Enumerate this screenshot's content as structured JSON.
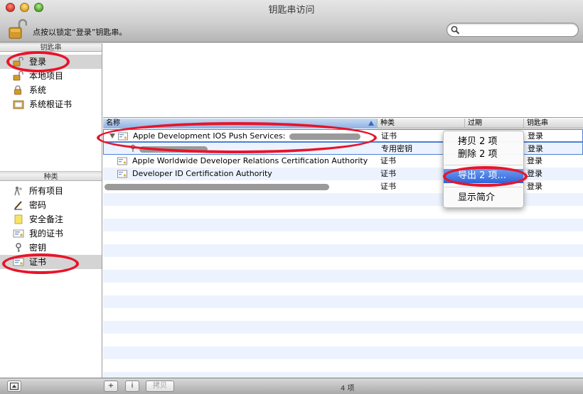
{
  "window": {
    "title": "钥匙串访问",
    "lock_text": "点按以锁定“登录”钥匙串。",
    "search_placeholder": ""
  },
  "sidebar": {
    "keychains_header": "钥匙串",
    "keychains": [
      {
        "label": "登录",
        "icon": "open-lock-icon",
        "selected": true
      },
      {
        "label": "本地项目",
        "icon": "open-lock-icon",
        "selected": false
      },
      {
        "label": "系统",
        "icon": "lock-icon",
        "selected": false
      },
      {
        "label": "系统根证书",
        "icon": "certificate-folder-icon",
        "selected": false
      }
    ],
    "category_header": "种类",
    "categories": [
      {
        "label": "所有项目",
        "icon": "people-icon",
        "selected": false
      },
      {
        "label": "密码",
        "icon": "pencil-icon",
        "selected": false
      },
      {
        "label": "安全备注",
        "icon": "note-icon",
        "selected": false
      },
      {
        "label": "我的证书",
        "icon": "certificate-icon",
        "selected": false
      },
      {
        "label": "密钥",
        "icon": "key-icon",
        "selected": false
      },
      {
        "label": "证书",
        "icon": "certificate-icon",
        "selected": true
      }
    ]
  },
  "table": {
    "columns": {
      "name": "名称",
      "kind": "种类",
      "expires": "过期",
      "keychain": "钥匙串"
    },
    "rows": [
      {
        "name": "Apple Development IOS Push Services:",
        "kind": "证书",
        "keychain": "登录"
      },
      {
        "name": "",
        "kind": "专用密钥",
        "keychain": "登录"
      },
      {
        "name": "Apple Worldwide Developer Relations Certification Authority",
        "kind": "证书",
        "keychain": "登录"
      },
      {
        "name": "Developer ID Certification Authority",
        "kind": "证书",
        "keychain": "登录"
      },
      {
        "name": "",
        "kind": "证书",
        "keychain": "登录"
      }
    ]
  },
  "context_menu": {
    "copy": "拷贝 2 项",
    "delete": "删除 2 项",
    "export": "导出 2 项...",
    "get_info": "显示简介"
  },
  "bottombar": {
    "add": "+",
    "info": "i",
    "copy": "拷贝",
    "count": "4 项"
  }
}
